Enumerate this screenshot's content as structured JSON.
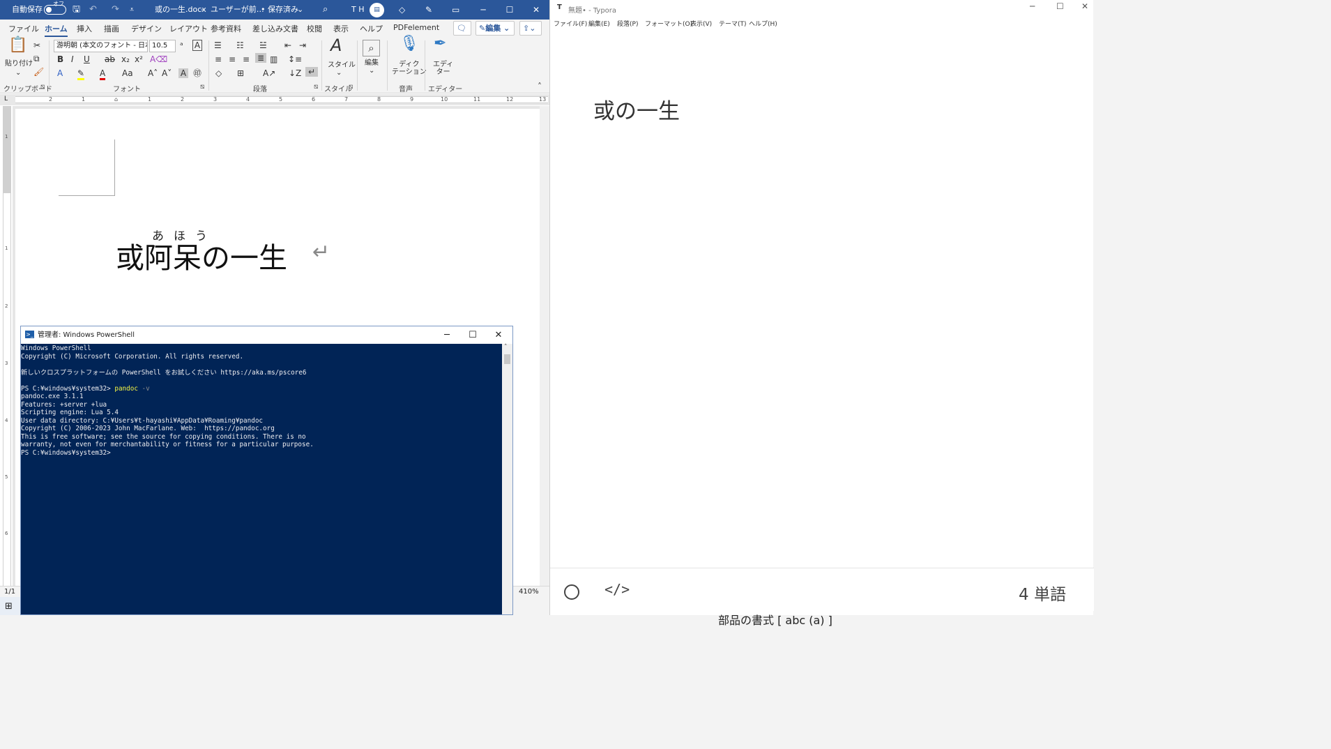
{
  "word": {
    "autosave_label": "自動保存",
    "autosave_state": "オフ",
    "title": "或の一生.docx",
    "title_user": "ユーザーが前…",
    "save_status": "保存済み",
    "user_initials": "T H",
    "tabs": [
      "ファイル",
      "ホーム",
      "挿入",
      "描画",
      "デザイン",
      "レイアウト",
      "参考資料",
      "差し込み文書",
      "校閲",
      "表示",
      "ヘルプ",
      "PDFelement"
    ],
    "active_tab": "ホーム",
    "edit_mode": "編集",
    "ribbon": {
      "paste": "貼り付け",
      "font_name": "游明朝 (本文のフォント - 日本",
      "font_size": "10.5",
      "style": "スタイル",
      "edit": "編集",
      "dictation": "ディク\nテーション",
      "editor": "エディ\nター",
      "groups": [
        "クリップボード",
        "フォント",
        "段落",
        "スタイル",
        "音声",
        "エディター"
      ]
    },
    "doc": {
      "ruby": "あほう",
      "heading": "或阿呆の一生",
      "para_mark": "↵"
    },
    "status": {
      "page": "1/1",
      "zoom": "410%"
    }
  },
  "powershell": {
    "title": "管理者: Windows PowerShell",
    "lines": [
      {
        "text": "Windows PowerShell"
      },
      {
        "text": "Copyright (C) Microsoft Corporation. All rights reserved."
      },
      {
        "text": ""
      },
      {
        "text": "新しいクロスプラットフォームの PowerShell をお試しください https://aka.ms/pscore6"
      },
      {
        "text": ""
      },
      {
        "prompt": "PS C:¥windows¥system32> ",
        "cmd": "pandoc",
        "arg": " -v"
      },
      {
        "text": "pandoc.exe 3.1.1"
      },
      {
        "text": "Features: +server +lua"
      },
      {
        "text": "Scripting engine: Lua 5.4"
      },
      {
        "text": "User data directory: C:¥Users¥t-hayashi¥AppData¥Roaming¥pandoc"
      },
      {
        "text": "Copyright (C) 2006-2023 John MacFarlane. Web:  https://pandoc.org"
      },
      {
        "text": "This is free software; see the source for copying conditions. There is no"
      },
      {
        "text": "warranty, not even for merchantability or fitness for a particular purpose."
      },
      {
        "text": "PS C:¥windows¥system32>"
      }
    ]
  },
  "typora": {
    "title": "無題• - Typora",
    "menu": [
      "ファイル(F)",
      "編集(E)",
      "段落(P)",
      "フォーマット(O)",
      "表示(V)",
      "テーマ(T)",
      "ヘルプ(H)"
    ],
    "heading": "或の一生",
    "word_count": "4 単語"
  },
  "background_peek": "部品の書式   [ abc (a) ]"
}
